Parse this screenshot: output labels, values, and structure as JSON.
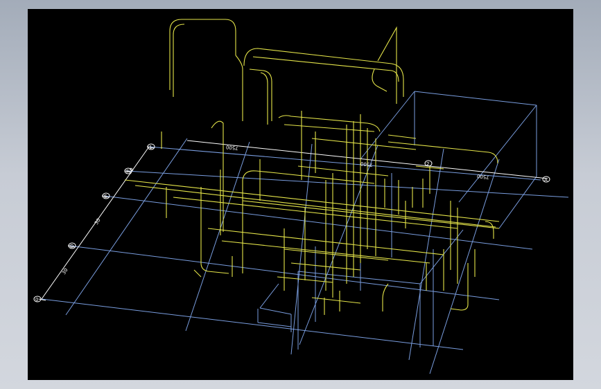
{
  "viewport": {
    "background": "#000000",
    "grid_color": "#7a9ee0",
    "pipe_color": "#e6e64a",
    "dimension_color": "#ffffff"
  },
  "dimensions": {
    "overall_left": "7500",
    "overall_mid": "7500",
    "overall_right": "7500",
    "bay_1": "30",
    "bay_2": "30",
    "bay_3": "30"
  },
  "axis_bubbles": {
    "y_axis": [
      "0",
      "D",
      "E",
      "F"
    ],
    "x_axis": [
      "1",
      "2",
      "A"
    ]
  }
}
